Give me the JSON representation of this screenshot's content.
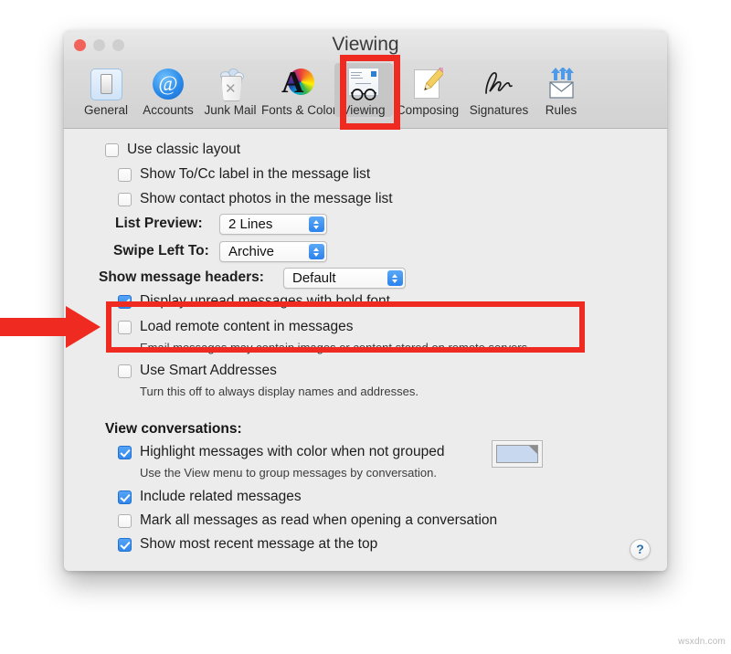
{
  "window": {
    "title": "Viewing",
    "traffic_lights": [
      "close",
      "minimize",
      "maximize"
    ]
  },
  "toolbar": {
    "items": [
      {
        "label": "General",
        "icon": "general-icon",
        "selected": false
      },
      {
        "label": "Accounts",
        "icon": "at-sign-icon",
        "selected": false
      },
      {
        "label": "Junk Mail",
        "icon": "trash-can-icon",
        "selected": false
      },
      {
        "label": "Fonts & Color",
        "icon": "color-wheel-icon",
        "selected": false
      },
      {
        "label": "Viewing",
        "icon": "eyeglasses-icon",
        "selected": true
      },
      {
        "label": "Composing",
        "icon": "pencil-icon",
        "selected": false
      },
      {
        "label": "Signatures",
        "icon": "signature-icon",
        "selected": false
      },
      {
        "label": "Rules",
        "icon": "envelope-arrows-icon",
        "selected": false
      }
    ]
  },
  "settings": {
    "use_classic_layout": {
      "label": "Use classic layout",
      "checked": false
    },
    "show_tocc_label": {
      "label": "Show To/Cc label in the message list",
      "checked": false
    },
    "show_contact_photos": {
      "label": "Show contact photos in the message list",
      "checked": false
    },
    "list_preview": {
      "label": "List Preview:",
      "value": "2 Lines"
    },
    "swipe_left_to": {
      "label": "Swipe Left To:",
      "value": "Archive"
    },
    "show_message_headers": {
      "label": "Show message headers:",
      "value": "Default"
    },
    "display_unread_bold": {
      "label": "Display unread messages with bold font",
      "checked": true
    },
    "load_remote_content": {
      "label": "Load remote content in messages",
      "checked": false,
      "note": "Email messages may contain images or content stored on remote servers."
    },
    "use_smart_addresses": {
      "label": "Use Smart Addresses",
      "checked": false,
      "note": "Turn this off to always display names and addresses."
    }
  },
  "conversations": {
    "heading": "View conversations:",
    "highlight_color": {
      "label": "Highlight messages with color when not grouped",
      "checked": true,
      "note": "Use the View menu to group messages by conversation.",
      "swatch_color": "#c7d8ef"
    },
    "include_related": {
      "label": "Include related messages",
      "checked": true
    },
    "mark_all_read": {
      "label": "Mark all messages as read when opening a conversation",
      "checked": false
    },
    "most_recent_top": {
      "label": "Show most recent message at the top",
      "checked": true
    }
  },
  "help": {
    "label": "?"
  },
  "annotations": {
    "highlight_color": "#ef2b21",
    "tab_callout": "Viewing",
    "option_callout": "Load remote content in messages"
  },
  "watermark": {
    "text": "wsxdn.com"
  }
}
